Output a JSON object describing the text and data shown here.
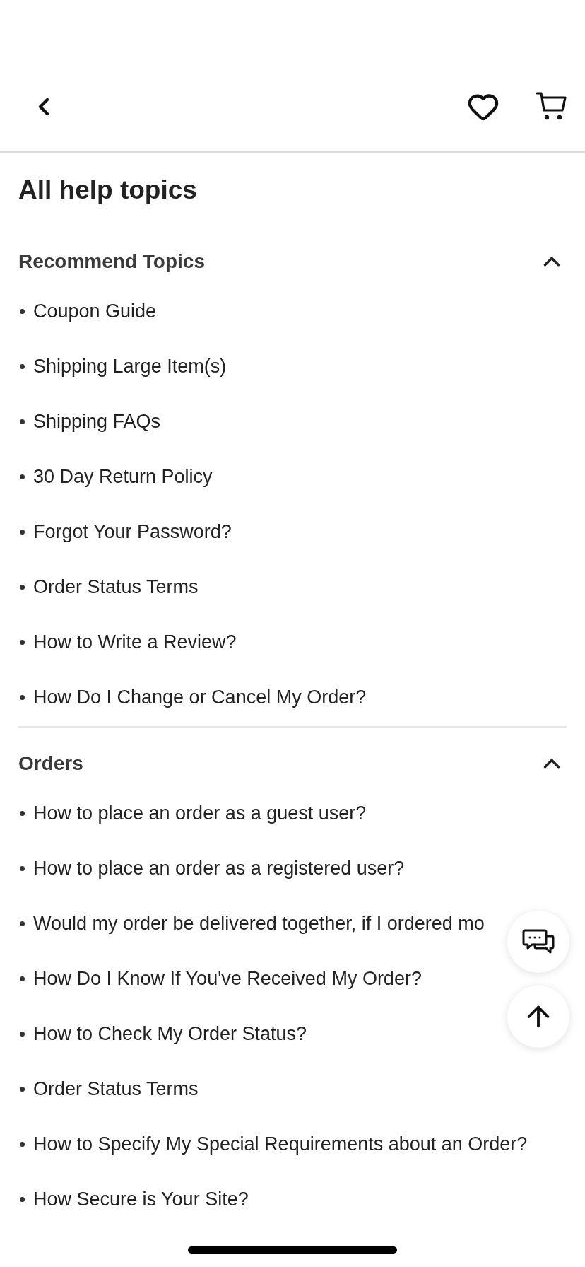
{
  "title": "All help topics",
  "sections": [
    {
      "title": "Recommend Topics",
      "expanded": true,
      "items": [
        "Coupon Guide",
        "Shipping Large Item(s)",
        "Shipping FAQs",
        "30 Day Return Policy",
        "Forgot Your Password?",
        "Order Status Terms",
        "How to Write a Review?",
        "How Do I Change or Cancel My Order?"
      ]
    },
    {
      "title": "Orders",
      "expanded": true,
      "items": [
        "How to place an order as a guest user?",
        "How to place an order as a registered user?",
        "Would my order be delivered together, if I ordered mo",
        "How Do I Know If You've Received My Order?",
        "How to Check My Order Status?",
        "Order Status Terms",
        "How to Specify My Special Requirements about an Order?",
        "How Secure is Your Site?"
      ]
    }
  ]
}
